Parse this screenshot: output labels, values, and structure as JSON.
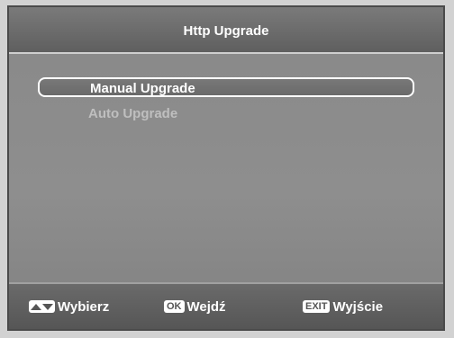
{
  "window": {
    "title": "Http Upgrade"
  },
  "menu": {
    "items": [
      {
        "label": "Manual Upgrade",
        "selected": true
      },
      {
        "label": "Auto Upgrade",
        "selected": false
      }
    ]
  },
  "footer": {
    "hints": [
      {
        "key_icon": "up-down-arrows-icon",
        "label": "Wybierz"
      },
      {
        "key": "OK",
        "label": "Wejdź"
      },
      {
        "key": "EXIT",
        "label": "Wyjście"
      }
    ]
  },
  "colors": {
    "frame": "#7c7c7c",
    "text": "#ffffff",
    "dim_text": "#bfbfbf"
  }
}
